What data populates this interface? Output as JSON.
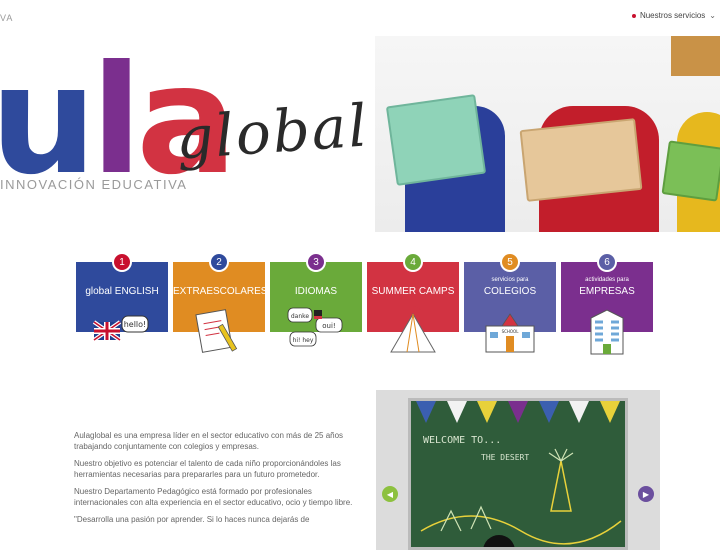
{
  "header": {
    "left_text": "VA",
    "services_label": "Nuestros servicios"
  },
  "logo": {
    "letters": [
      "u",
      "l",
      "a"
    ],
    "script": "global",
    "tagline": "INNOVACIÓN EDUCATIVA"
  },
  "cards": [
    {
      "number": "1",
      "subtitle": "",
      "title": "global ENGLISH",
      "color": "#2f4a9c",
      "badge": "#c8102e",
      "icon": "uk-flag-hello-icon"
    },
    {
      "number": "2",
      "subtitle": "",
      "title": "EXTRAESCOLARES",
      "color": "#e08c22",
      "badge": "#2f4a9c",
      "icon": "notebook-pencil-icon"
    },
    {
      "number": "3",
      "subtitle": "",
      "title": "IDIOMAS",
      "color": "#6aaa3a",
      "badge": "#7b2f8e",
      "icon": "speech-bubbles-icon"
    },
    {
      "number": "4",
      "subtitle": "",
      "title": "SUMMER CAMPS",
      "color": "#d23342",
      "badge": "#6aaa3a",
      "icon": "tent-icon"
    },
    {
      "number": "5",
      "subtitle": "servicios para",
      "title": "COLEGIOS",
      "color": "#5b5fa6",
      "badge": "#e08c22",
      "icon": "school-building-icon"
    },
    {
      "number": "6",
      "subtitle": "actividades para",
      "title": "EMPRESAS",
      "color": "#7b2f8e",
      "badge": "#5b5fa6",
      "icon": "office-building-icon"
    }
  ],
  "cards_illus_labels": {
    "hello": "hello!",
    "danke": "danke",
    "oui": "oui!",
    "hi": "hi! hey",
    "school": "SCHOOL"
  },
  "about": {
    "paragraphs": [
      "Aulaglobal es una empresa líder en el sector educativo con más de 25 años trabajando conjuntamente con colegios y empresas.",
      "Nuestro objetivo es potenciar el talento de cada niño proporcionándoles las herramientas necesarias para prepararles para un futuro prometedor.",
      "Nuestro Departamento Pedagógico está formado por profesionales internacionales con alta experiencia en el sector educativo, ocio y tiempo libre.",
      "\"Desarrolla una pasión por aprender. Si lo haces nunca dejarás de"
    ]
  },
  "slider": {
    "board_text_1": "WELCOME TO...",
    "board_text_2": "THE DESERT",
    "prev_color": "#8dc13f",
    "next_color": "#6b4f9e"
  }
}
